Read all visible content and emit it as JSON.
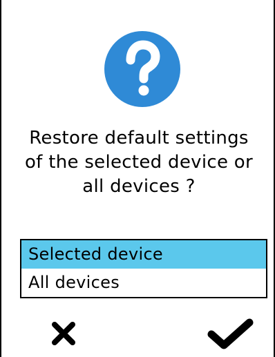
{
  "dialog": {
    "icon": "question-mark-icon",
    "accent_color": "#2f8ad6",
    "selection_color": "#5bc8ec",
    "prompt_lines": [
      "Restore default settings",
      "of the selected device or",
      "all devices ?"
    ],
    "options": [
      {
        "label": "Selected device",
        "selected": true
      },
      {
        "label": "All devices",
        "selected": false
      }
    ],
    "actions": {
      "cancel_icon": "close-icon",
      "confirm_icon": "checkmark-icon"
    }
  }
}
